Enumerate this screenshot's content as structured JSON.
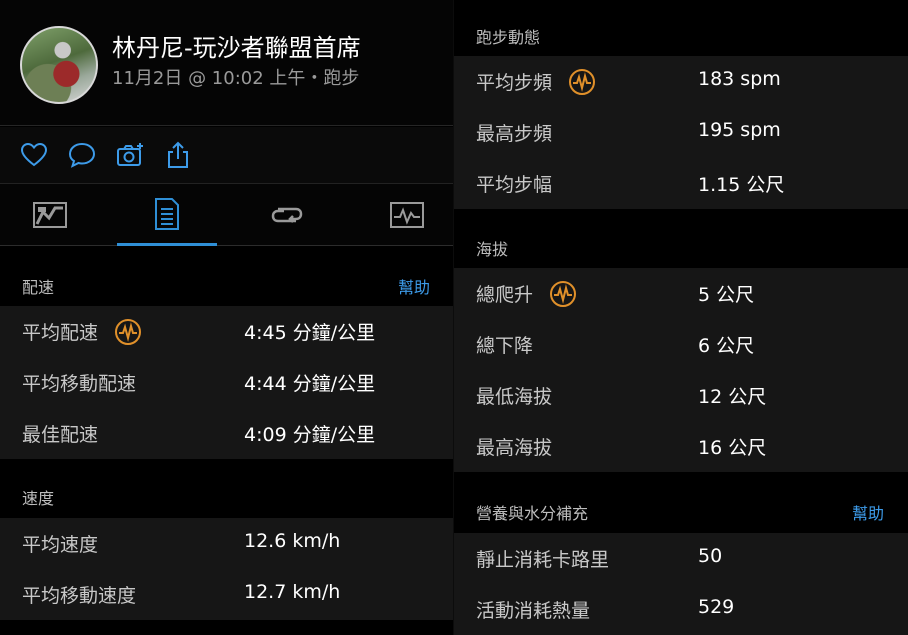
{
  "activity": {
    "user_name": "林丹尼-玩沙者聯盟首席",
    "subtitle": "11月2日 @ 10:02 上午・跑步"
  },
  "actions": {
    "icons": [
      "heart-icon",
      "comment-icon",
      "camera-add-icon",
      "share-icon"
    ]
  },
  "tabs": [
    {
      "icon": "map-overview-icon",
      "active": false
    },
    {
      "icon": "stats-list-icon",
      "active": true
    },
    {
      "icon": "laps-icon",
      "active": false
    },
    {
      "icon": "chart-icon",
      "active": false
    }
  ],
  "colors": {
    "accent": "#2f8fd6",
    "help_link": "#3d9be9",
    "gauge": "#e0902a",
    "row_bg": "#161616"
  },
  "pace": {
    "title": "配速",
    "help": "幫助",
    "rows": [
      {
        "label": "平均配速",
        "value": "4:45 分鐘/公里",
        "icon": "performance-gauge-icon"
      },
      {
        "label": "平均移動配速",
        "value": "4:44 分鐘/公里"
      },
      {
        "label": "最佳配速",
        "value": "4:09 分鐘/公里"
      }
    ]
  },
  "speed": {
    "title": "速度",
    "rows": [
      {
        "label": "平均速度",
        "value": "12.6 km/h"
      },
      {
        "label": "平均移動速度",
        "value": "12.7 km/h"
      }
    ]
  },
  "running_dynamics": {
    "title": "跑步動態",
    "rows": [
      {
        "label": "平均步頻",
        "value": "183 spm",
        "icon": "performance-gauge-icon"
      },
      {
        "label": "最高步頻",
        "value": "195 spm"
      },
      {
        "label": "平均步幅",
        "value": "1.15 公尺"
      }
    ]
  },
  "elevation": {
    "title": "海拔",
    "rows": [
      {
        "label": "總爬升",
        "value": "5 公尺",
        "icon": "performance-gauge-icon"
      },
      {
        "label": "總下降",
        "value": "6 公尺"
      },
      {
        "label": "最低海拔",
        "value": "12 公尺"
      },
      {
        "label": "最高海拔",
        "value": "16 公尺"
      }
    ]
  },
  "nutrition": {
    "title": "營養與水分補充",
    "help": "幫助",
    "rows": [
      {
        "label": "靜止消耗卡路里",
        "value": "50"
      },
      {
        "label": "活動消耗熱量",
        "value": "529"
      }
    ]
  }
}
